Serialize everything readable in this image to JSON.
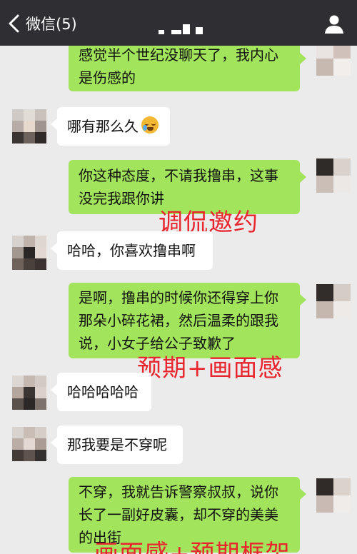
{
  "header": {
    "back_label": "微信(5)",
    "icons": [
      "chevron-left-icon",
      "person-icon"
    ],
    "colors": {
      "bar": "#2e2e33",
      "text": "#ffffff"
    }
  },
  "messages": [
    {
      "side": "out",
      "lines": [
        "感觉半个世纪没聊天了，我内心",
        "是伤感的"
      ]
    },
    {
      "side": "in",
      "lines": [
        "哪有那么久"
      ],
      "emoji": "crying-laughing-emoji"
    },
    {
      "side": "out",
      "lines": [
        "你这种态度，不请我撸串，这事",
        "没完我跟你讲"
      ]
    },
    {
      "side": "in",
      "lines": [
        "哈哈，你喜欢撸串啊"
      ]
    },
    {
      "side": "out",
      "lines": [
        "是啊，撸串的时候你还得穿上你",
        "那朵小碎花裙，然后温柔的跟我",
        "说，小女子给公子致歉了"
      ]
    },
    {
      "side": "in",
      "lines": [
        "哈哈哈哈哈"
      ]
    },
    {
      "side": "in",
      "lines": [
        "那我要是不穿呢"
      ]
    },
    {
      "side": "out",
      "lines": [
        "不穿，我就告诉警察叔叔，说你",
        "长了一副好皮囊，却不穿的美美",
        "的出街"
      ]
    }
  ],
  "annotations": [
    "调侃邀约",
    "预期+画面感",
    "画面感+预期框架"
  ],
  "colors": {
    "background": "#ebebeb",
    "bubble_out": "#a2e55c",
    "bubble_in": "#ffffff",
    "annotation": "#e8252d"
  }
}
